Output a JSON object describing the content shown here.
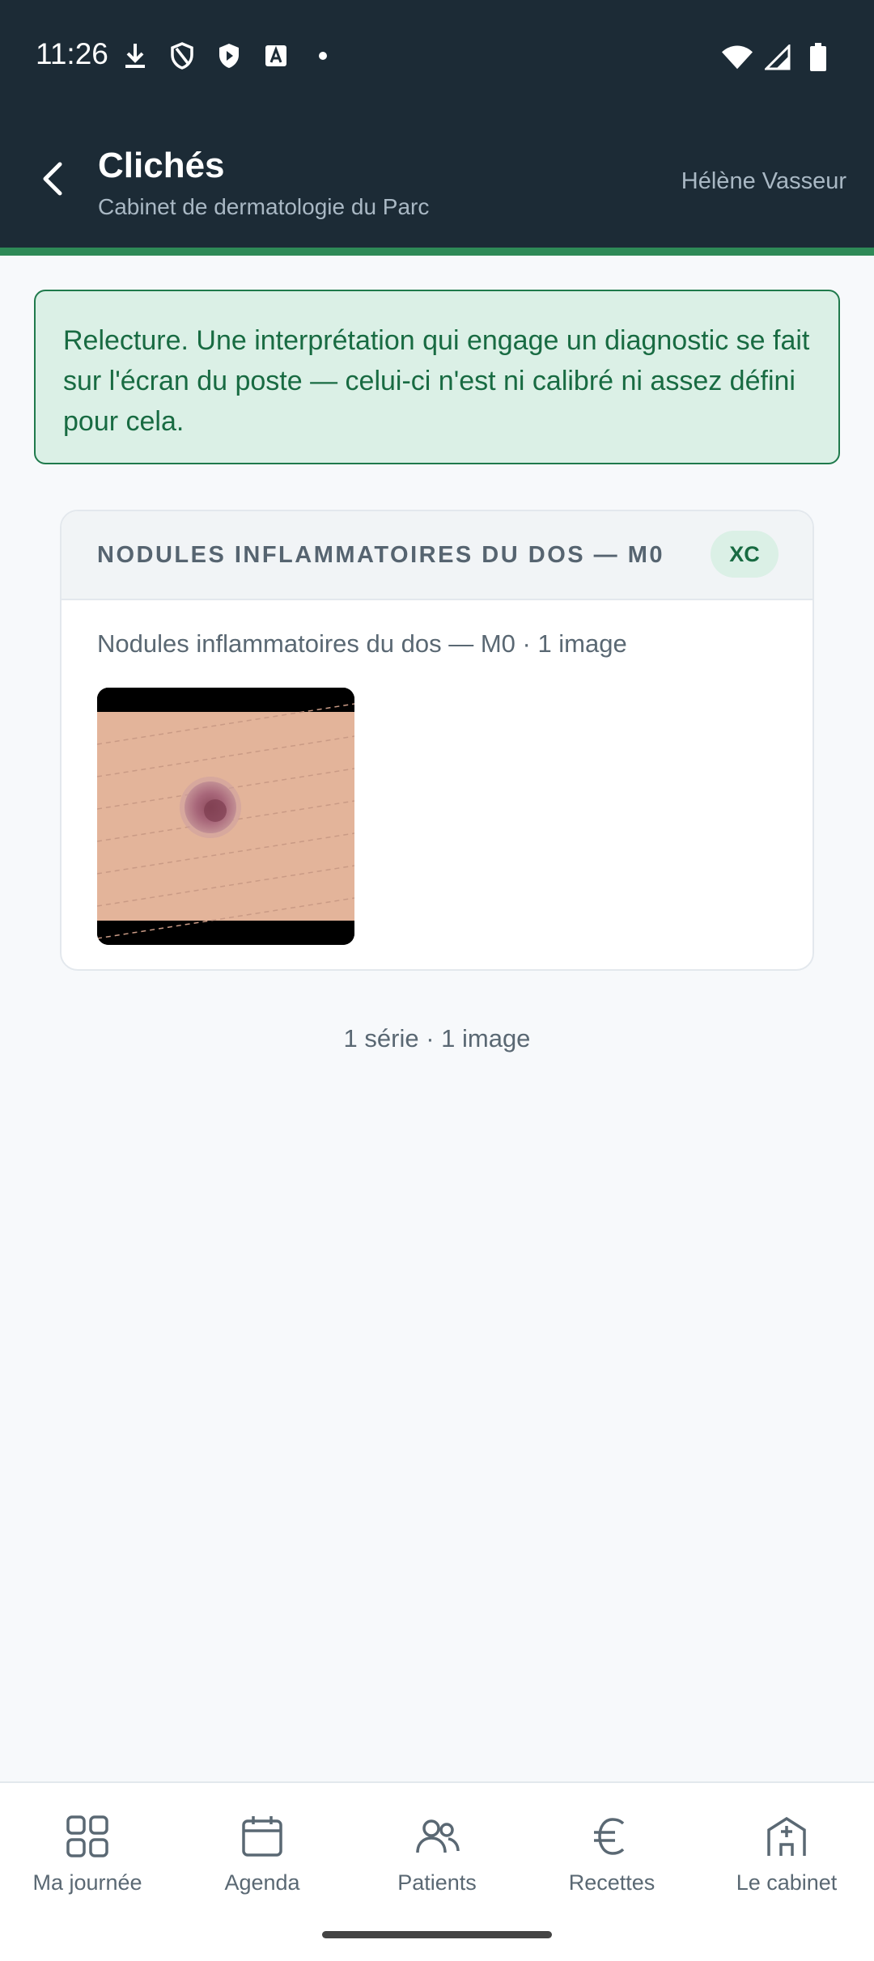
{
  "status_bar": {
    "time": "11:26",
    "left_icons": [
      "download-icon",
      "shield-outline-icon",
      "shield-play-icon",
      "text-a-icon",
      "dot-icon"
    ],
    "right_icons": [
      "wifi-icon",
      "signal-icon",
      "battery-icon"
    ]
  },
  "appbar": {
    "title": "Clichés",
    "subtitle": "Cabinet de dermatologie du Parc",
    "user": "Hélène Vasseur",
    "back_icon": "chevron-left-icon"
  },
  "colors": {
    "header_bg": "#1c2b36",
    "accent": "#2e8a57",
    "notice_bg": "#dbf0e6",
    "notice_text": "#186b42"
  },
  "notice": {
    "text": "Relecture. Une interprétation qui engage un diagnostic se fait sur l'écran du poste — celui-ci n'est ni calibré ni assez défini pour cela."
  },
  "series": [
    {
      "title": "NODULES INFLAMMATOIRES DU DOS — M0",
      "modality": "XC",
      "description": "Nodules inflammatoires du dos — M0 · 1 image"
    }
  ],
  "summary": "1 série · 1 image",
  "nav": [
    {
      "label": "Ma journée",
      "icon": "grid-icon"
    },
    {
      "label": "Agenda",
      "icon": "calendar-icon"
    },
    {
      "label": "Patients",
      "icon": "users-icon"
    },
    {
      "label": "Recettes",
      "icon": "euro-icon"
    },
    {
      "label": "Le cabinet",
      "icon": "building-icon"
    }
  ]
}
